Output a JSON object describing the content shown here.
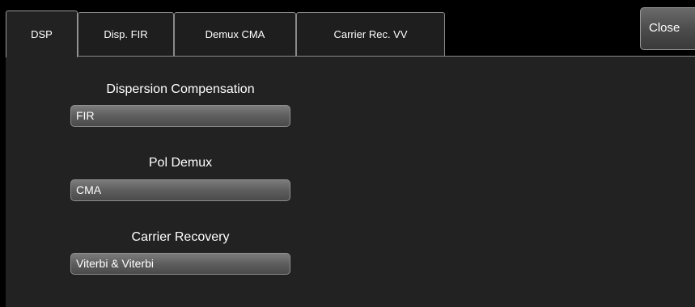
{
  "tabs": [
    {
      "label": "DSP",
      "active": true
    },
    {
      "label": "Disp. FIR",
      "active": false
    },
    {
      "label": "Demux CMA",
      "active": false
    },
    {
      "label": "Carrier Rec. VV",
      "active": false
    }
  ],
  "close_label": "Close",
  "fields": {
    "dispersion": {
      "label": "Dispersion Compensation",
      "value": "FIR"
    },
    "pol_demux": {
      "label": "Pol Demux",
      "value": "CMA"
    },
    "carrier": {
      "label": "Carrier Recovery",
      "value": "Viterbi & Viterbi"
    }
  },
  "colors": {
    "background": "#000000",
    "panel": "#222222",
    "border": "#8a8a8a",
    "text": "#ffffff"
  }
}
